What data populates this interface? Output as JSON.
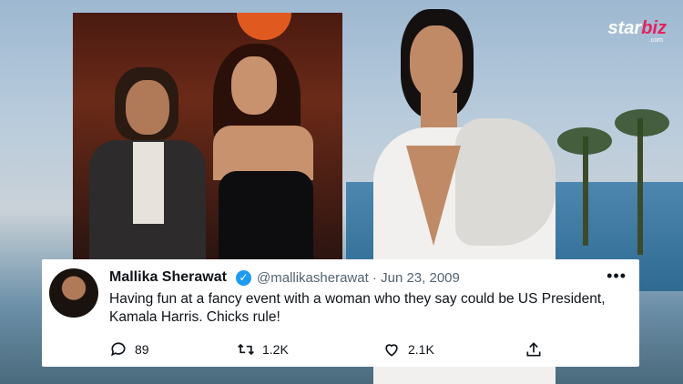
{
  "brand": {
    "name_part1": "star",
    "name_part2": "biz",
    "sub": ".com"
  },
  "tweet": {
    "name": "Mallika Sherawat",
    "handle_date": "@mallikasherawat · Jun 23, 2009",
    "text": "Having fun at a fancy event with a woman who they say could be US President, Kamala Harris. Chicks rule!",
    "more": "•••",
    "replies": "89",
    "retweets": "1.2K",
    "likes": "2.1K"
  },
  "icons": [
    "verified-badge-icon",
    "reply-icon",
    "retweet-icon",
    "like-icon",
    "share-icon",
    "more-icon"
  ]
}
